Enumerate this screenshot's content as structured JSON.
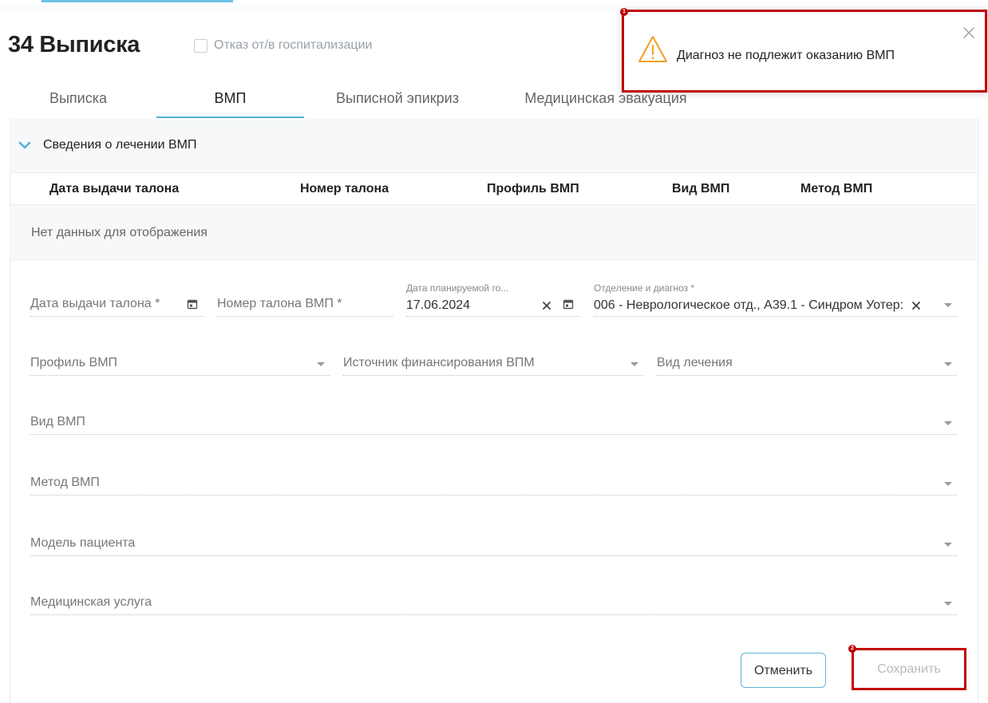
{
  "header": {
    "title": "34 Выписка",
    "refuse_label": "Отказ от/в госпитализации"
  },
  "tabs": [
    {
      "label": "Выписка",
      "active": false
    },
    {
      "label": "ВМП",
      "active": true
    },
    {
      "label": "Выписной эпикриз",
      "active": false
    },
    {
      "label": "Медицинская эвакуация",
      "active": false
    }
  ],
  "section": {
    "title": "Сведения о лечении ВМП",
    "table": {
      "columns": [
        "Дата выдачи талона",
        "Номер талона",
        "Профиль ВМП",
        "Вид ВМП",
        "Метод ВМП"
      ],
      "empty_text": "Нет данных для отображения"
    }
  },
  "form": {
    "issue_date": {
      "label": "Дата выдачи талона *"
    },
    "ticket_number": {
      "label": "Номер талона ВМП *"
    },
    "planned_date": {
      "label": "Дата планируемой го...",
      "value": "17.06.2024"
    },
    "department": {
      "label": "Отделение и диагноз *",
      "value": "006 - Неврологическое отд., A39.1 - Синдром Уотер:"
    },
    "profile": {
      "label": "Профиль ВМП"
    },
    "funding": {
      "label": "Источник финансирования ВПМ"
    },
    "treatment_type": {
      "label": "Вид лечения"
    },
    "vmp_type": {
      "label": "Вид ВМП"
    },
    "vmp_method": {
      "label": "Метод ВМП"
    },
    "patient_model": {
      "label": "Модель пациента"
    },
    "medical_service": {
      "label": "Медицинская услуга"
    }
  },
  "actions": {
    "cancel_label": "Отменить",
    "save_label": "Сохранить"
  },
  "notification": {
    "message": "Диагноз не подлежит оказанию ВМП",
    "icon": "warning-icon"
  },
  "markers": [
    "1",
    "2"
  ],
  "colors": {
    "accent": "#4fb0d8",
    "highlight": "#c00000",
    "warning": "#f0a020"
  }
}
